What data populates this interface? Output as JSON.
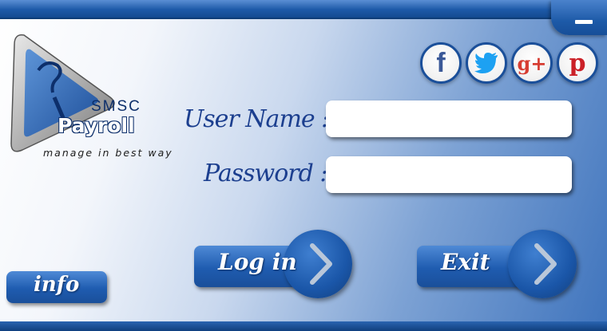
{
  "app": {
    "brand_top": "SMSC",
    "brand_name": "Payroll",
    "tagline": "manage in best way"
  },
  "window": {
    "minimize_icon": "minimize-icon"
  },
  "social": [
    {
      "name": "facebook",
      "glyph": "f",
      "color": "#3b5998"
    },
    {
      "name": "twitter",
      "glyph": "t",
      "color": "#1da1f2"
    },
    {
      "name": "google-plus",
      "glyph": "g+",
      "color": "#d73d32"
    },
    {
      "name": "pinterest",
      "glyph": "p",
      "color": "#cb2027"
    }
  ],
  "form": {
    "username_label": "User Name :",
    "username_value": "",
    "password_label": "Password :",
    "password_value": ""
  },
  "buttons": {
    "login_label": "Log in",
    "exit_label": "Exit",
    "info_label": "info",
    "chevron_icon": "chevron-right-icon"
  },
  "colors": {
    "accent": "#1f5cb0",
    "label_text": "#1c3f8f"
  }
}
